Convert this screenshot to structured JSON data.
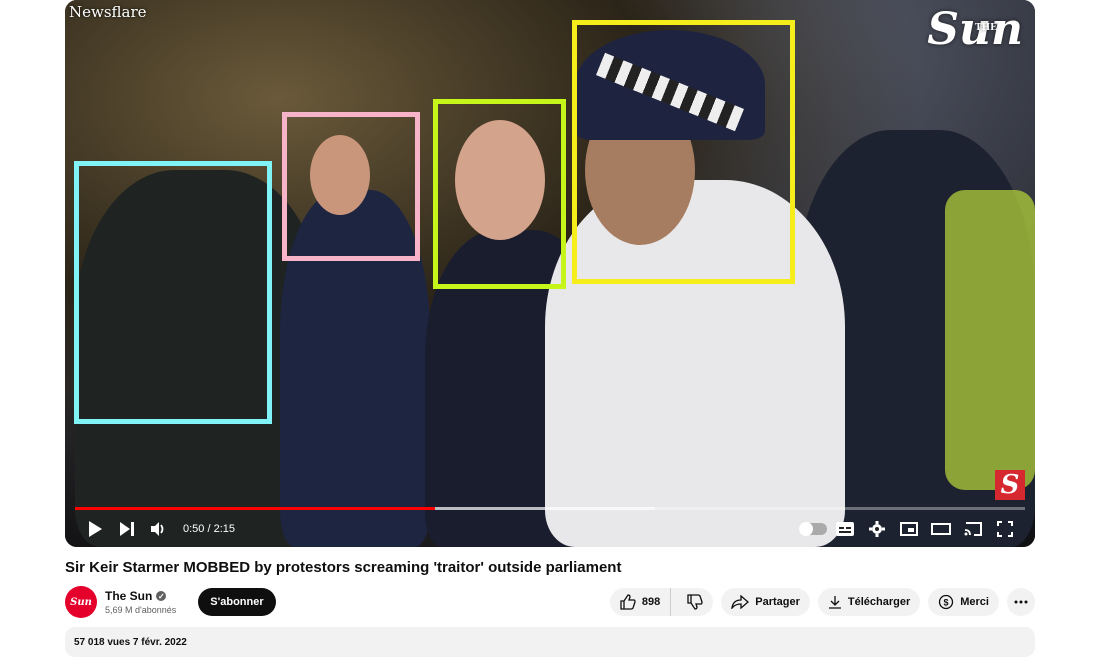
{
  "video": {
    "watermark": "Newsflare",
    "brand_logo_top": "THE",
    "brand_logo": "Sun",
    "brand_badge": "S",
    "progress_played_fraction": 0.379,
    "progress_buffered_fraction": 0.61,
    "time_display": "0:50 / 2:15",
    "annotation_box_colors": [
      "#7ff3f6",
      "#f7b3c8",
      "#c6f51a",
      "#f6ee1a"
    ]
  },
  "controls": {
    "icons": [
      "play-icon",
      "next-icon",
      "volume-icon",
      "autoplay-toggle",
      "subtitles-icon",
      "settings-icon",
      "miniplayer-icon",
      "theater-mode-icon",
      "cast-icon",
      "fullscreen-icon"
    ]
  },
  "page": {
    "title": "Sir Keir Starmer MOBBED by protestors screaming 'traitor' outside parliament"
  },
  "channel": {
    "avatar_text": "Sun",
    "name": "The Sun",
    "subscribers": "5,69 M d'abonnés",
    "subscribe_label": "S'abonner"
  },
  "actions": {
    "likes": "898",
    "share_label": "Partager",
    "download_label": "Télécharger",
    "thanks_label": "Merci"
  },
  "description": {
    "meta": "57 018 vues  7 févr. 2022"
  },
  "colors": {
    "progress": "#ff0000",
    "subscribe_bg": "#0f0f0f",
    "pill_bg": "#f2f2f2"
  }
}
